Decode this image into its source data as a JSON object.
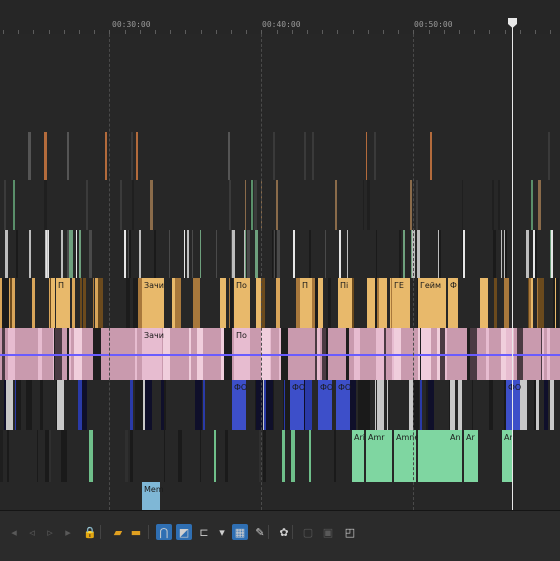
{
  "ruler": {
    "timecodes": [
      "00:30:00",
      "00:40:00",
      "00:50:00"
    ]
  },
  "colors": {
    "background": "#232323",
    "playhead": "#e8e8e8",
    "clip_orange": "#e8b96b",
    "clip_pink": "#e7bcd0",
    "clip_green": "#7fd6a1",
    "clip_blue": "#2a3aa8",
    "clip_teal": "#7fb7d6",
    "envelope": "#6a5cff",
    "accent": "#2f6fb3"
  },
  "clip_labels": {
    "orange": [
      "П",
      "Зачи",
      "По",
      "П",
      "Пі",
      "ГЕ",
      "Гейм",
      "Ф"
    ],
    "pink": [
      "Зачи",
      "По"
    ],
    "blue": [
      "ФО",
      "ФО",
      "ФО",
      "ФО",
      "ФО"
    ],
    "green": [
      "Ari",
      "Amr",
      "Amnes",
      "An",
      "Ar",
      "Ar"
    ],
    "teal": [
      "Mem"
    ]
  },
  "toolbar": {
    "tools": [
      {
        "icon": "prev-marker-icon",
        "state": "disabled"
      },
      {
        "icon": "prev-region-icon",
        "state": "disabled"
      },
      {
        "icon": "next-region-icon",
        "state": "disabled"
      },
      {
        "icon": "next-marker-icon",
        "state": "disabled"
      },
      {
        "icon": "lock-icon",
        "state": "normal"
      },
      {
        "icon": "marker-icon",
        "state": "normal"
      },
      {
        "icon": "region-icon",
        "state": "normal"
      },
      {
        "icon": "snap-magnet-icon",
        "state": "active"
      },
      {
        "icon": "auto-ripple-icon",
        "state": "active"
      },
      {
        "icon": "trim-icon",
        "state": "normal"
      },
      {
        "icon": "dropdown-icon",
        "state": "normal"
      },
      {
        "icon": "ignore-grouping-icon",
        "state": "active"
      },
      {
        "icon": "envelope-edit-icon",
        "state": "normal"
      },
      {
        "icon": "color-match-icon",
        "state": "normal"
      },
      {
        "icon": "group-icon",
        "state": "disabled"
      },
      {
        "icon": "ungroup-icon",
        "state": "disabled"
      },
      {
        "icon": "lock-group-icon",
        "state": "normal"
      }
    ]
  }
}
